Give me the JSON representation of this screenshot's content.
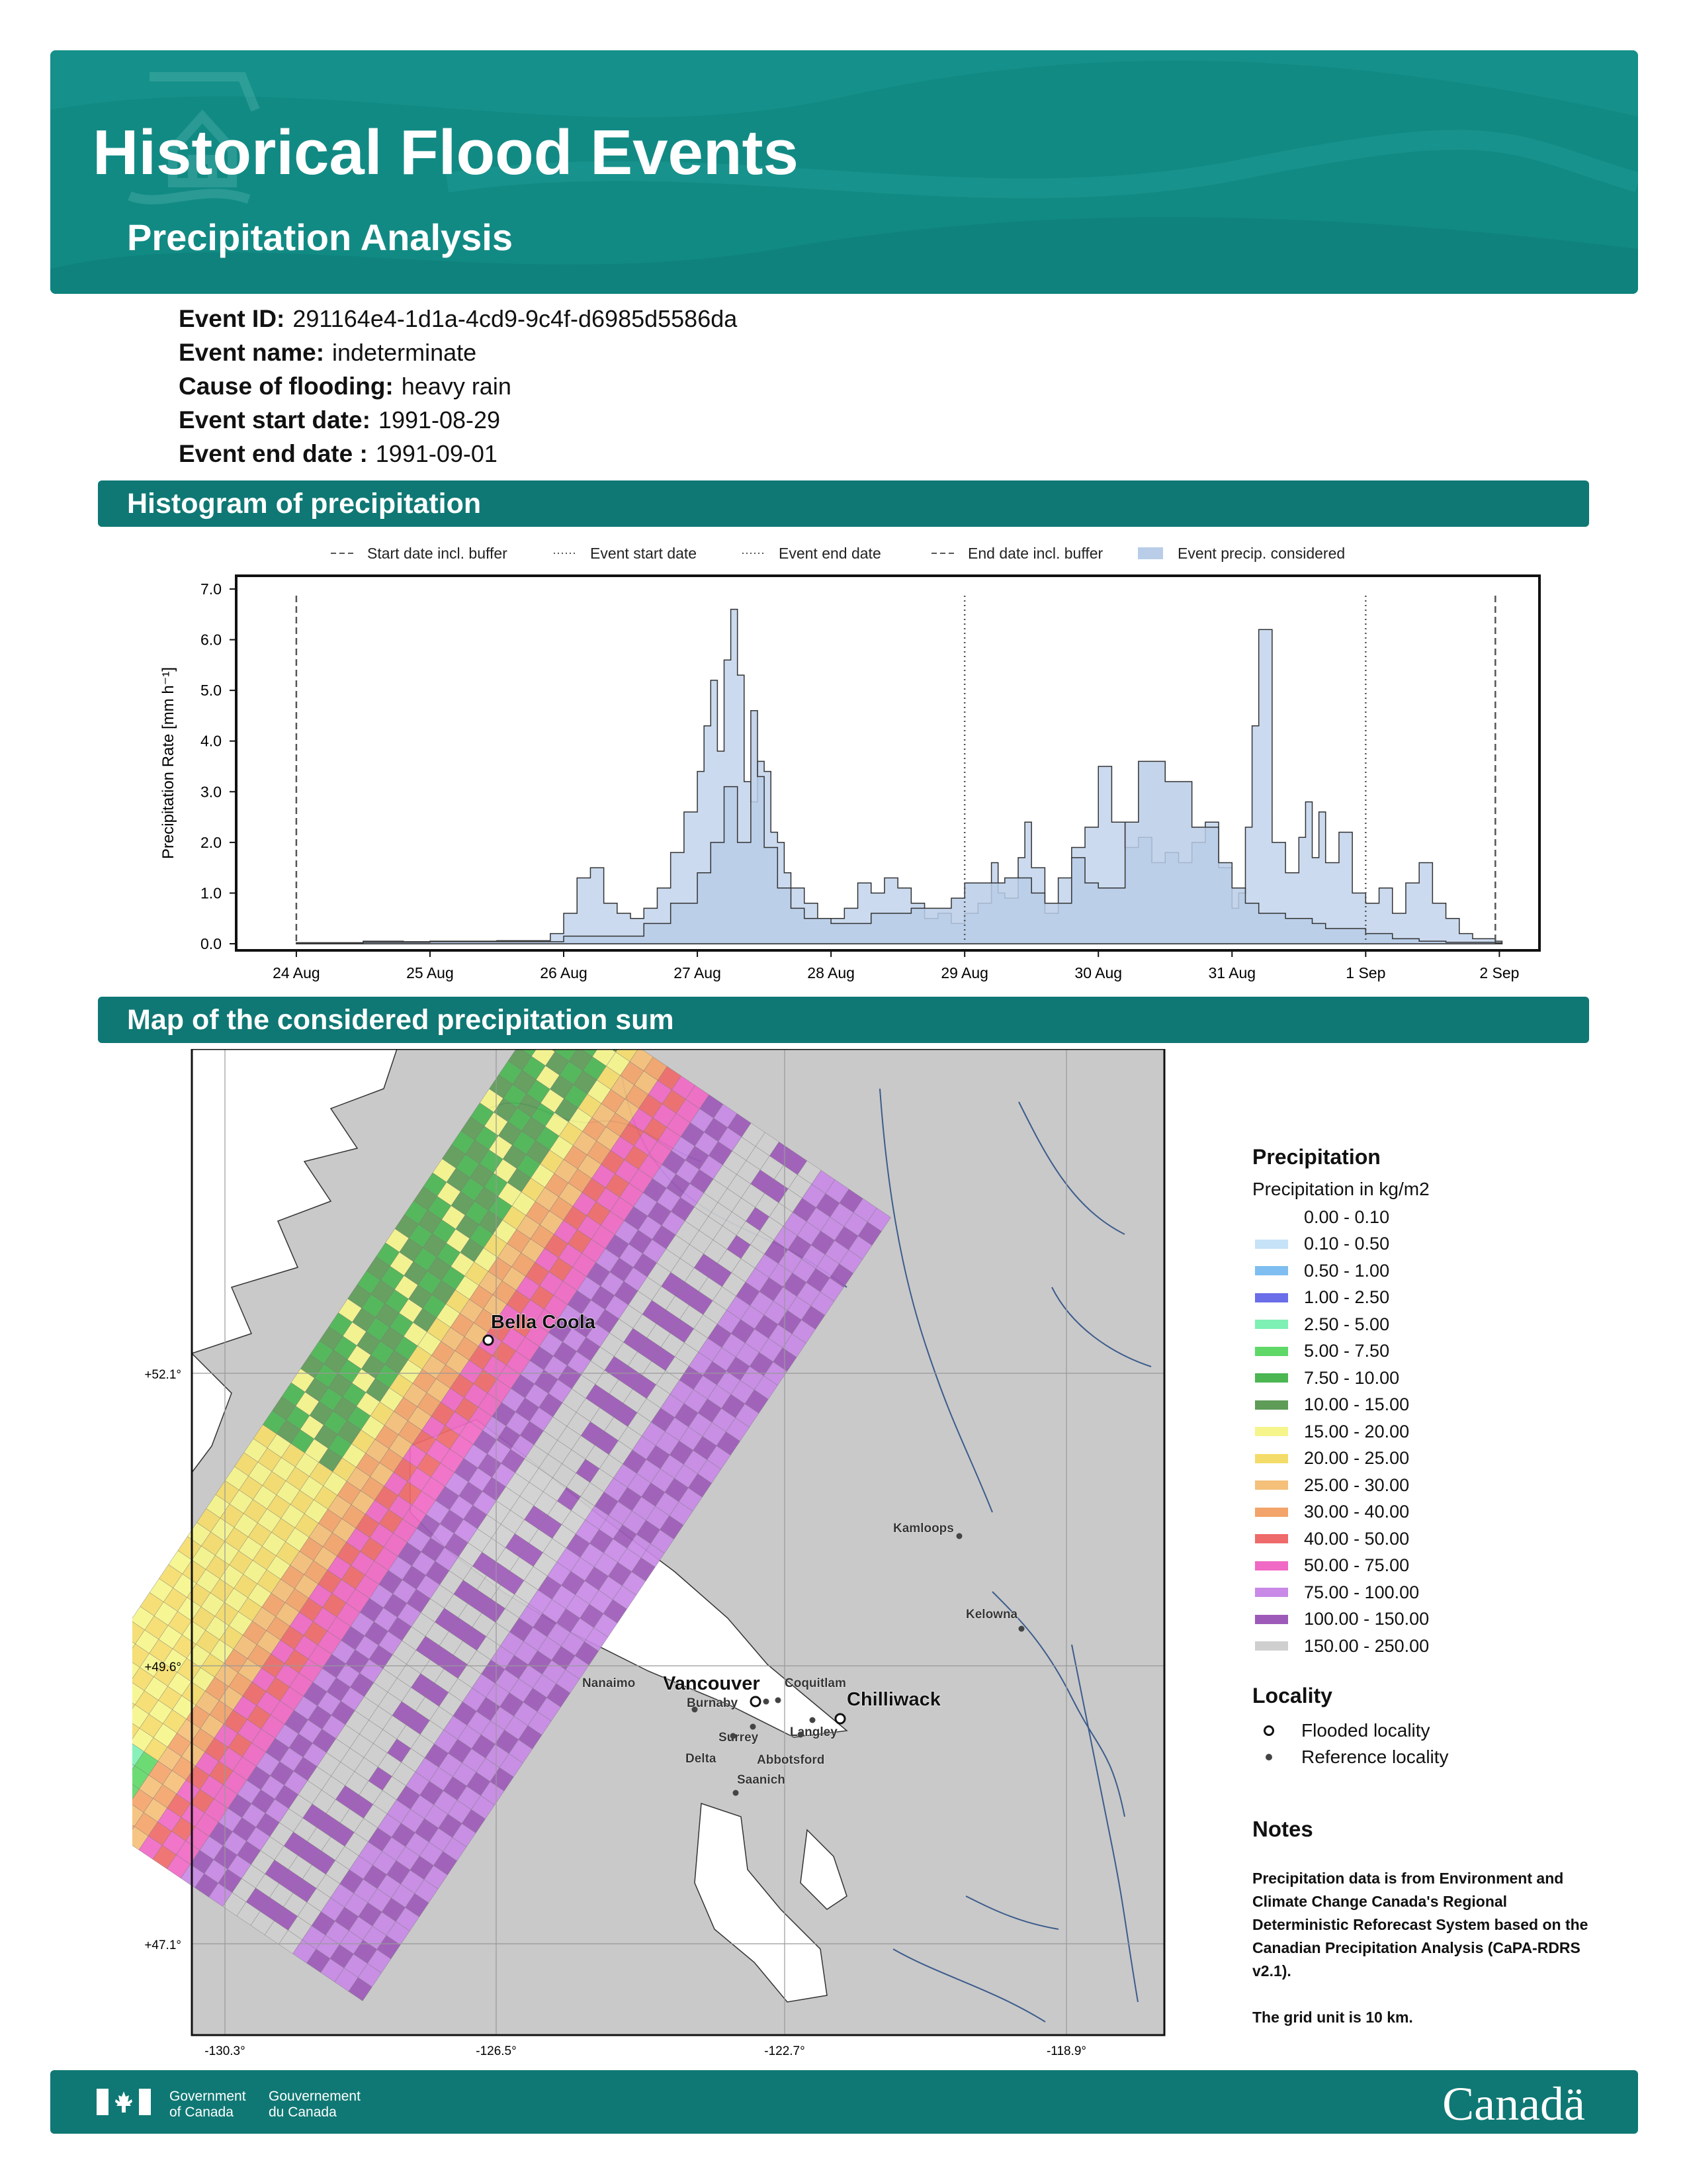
{
  "header": {
    "title": "Historical Flood Events",
    "subtitle": "Precipitation Analysis"
  },
  "event": [
    {
      "label": "Event ID:",
      "value": "291164e4-1d1a-4cd9-9c4f-d6985d5586da"
    },
    {
      "label": "Event name:",
      "value": "indeterminate"
    },
    {
      "label": "Cause of flooding:",
      "value": "heavy rain"
    },
    {
      "label": "Event start date:",
      "value": "1991-08-29"
    },
    {
      "label": "Event end date :",
      "value": "1991-09-01"
    }
  ],
  "sections": {
    "histogram": "Histogram of precipitation",
    "map": "Map of the considered precipitation sum"
  },
  "chart_data": {
    "type": "area",
    "xlabel": "",
    "ylabel": "Precipitation Rate [mm h⁻¹]",
    "ylim": [
      0,
      7
    ],
    "yticks": [
      "0.0",
      "1.0",
      "2.0",
      "3.0",
      "4.0",
      "5.0",
      "6.0",
      "7.0"
    ],
    "xticks": [
      "24 Aug",
      "25 Aug",
      "26 Aug",
      "27 Aug",
      "28 Aug",
      "29 Aug",
      "30 Aug",
      "31 Aug",
      "1 Sep",
      "2 Sep"
    ],
    "x_unit": "days after 24 Aug 00:00",
    "legend": [
      "Start date incl. buffer",
      "Event start date",
      "Event end date",
      "End date incl. buffer",
      "Event precip. considered"
    ],
    "vlines": [
      {
        "name": "Start date incl. buffer",
        "x": 0.0,
        "style": "dashed"
      },
      {
        "name": "Event start date",
        "x": 5.0,
        "style": "dotted"
      },
      {
        "name": "Event end date",
        "x": 8.0,
        "style": "dotted"
      },
      {
        "name": "End date incl. buffer",
        "x": 8.97,
        "style": "dashed"
      }
    ],
    "fill_color": "#b9cde8",
    "series": [
      {
        "x": [
          0,
          0.5,
          0.8,
          1,
          1.5,
          1.9,
          2,
          2.1,
          2.2,
          2.3,
          2.4,
          2.5,
          2.6,
          2.7,
          2.8,
          2.9,
          3,
          3.05,
          3.1,
          3.15,
          3.2,
          3.25,
          3.3,
          3.35,
          3.4,
          3.45,
          3.5,
          3.55,
          3.6,
          3.65,
          3.7,
          3.8,
          3.9,
          4,
          4.1,
          4.2,
          4.3,
          4.4,
          4.5,
          4.6,
          4.7,
          4.8,
          4.9,
          5,
          5.1,
          5.2,
          5.25,
          5.3,
          5.4,
          5.45,
          5.5,
          5.6,
          5.7,
          5.8,
          5.9,
          6,
          6.1,
          6.2,
          6.3,
          6.4,
          6.5,
          6.6,
          6.7,
          6.8,
          6.9,
          7,
          7.05,
          7.1,
          7.15,
          7.2,
          7.3,
          7.4,
          7.5,
          7.55,
          7.6,
          7.65,
          7.7,
          7.8,
          7.9,
          8,
          8.1,
          8.2,
          8.3,
          8.4,
          8.5,
          8.6,
          8.7,
          8.8,
          8.97
        ],
        "y": [
          0.02,
          0.05,
          0.04,
          0.05,
          0.06,
          0.2,
          0.6,
          1.3,
          1.5,
          0.8,
          0.6,
          0.5,
          0.7,
          1.1,
          1.8,
          2.6,
          3.4,
          4.3,
          5.2,
          3.8,
          5.6,
          6.6,
          5.3,
          3.2,
          2.8,
          3.6,
          3.4,
          2.2,
          2.0,
          1.4,
          1.1,
          0.8,
          0.5,
          0.5,
          0.7,
          1.2,
          1.0,
          1.3,
          1.1,
          0.8,
          0.5,
          0.6,
          0.4,
          0.6,
          0.8,
          1.6,
          1.0,
          0.9,
          1.7,
          2.4,
          1.5,
          0.6,
          1.3,
          1.9,
          2.3,
          3.5,
          2.4,
          1.9,
          2.1,
          1.6,
          1.8,
          1.6,
          2.0,
          2.4,
          1.5,
          0.7,
          1.0,
          2.3,
          4.3,
          6.2,
          2.0,
          1.4,
          2.1,
          2.8,
          1.7,
          2.6,
          1.6,
          2.2,
          1.0,
          0.8,
          1.1,
          0.6,
          1.2,
          1.6,
          0.8,
          0.5,
          0.2,
          0.1,
          0.05
        ]
      },
      {
        "x": [
          0,
          0.5,
          1,
          2,
          2.6,
          2.8,
          3,
          3.1,
          3.2,
          3.3,
          3.4,
          3.45,
          3.5,
          3.6,
          3.7,
          3.8,
          4,
          4.3,
          4.6,
          4.9,
          5,
          5.3,
          5.5,
          5.6,
          5.8,
          5.9,
          6,
          6.2,
          6.3,
          6.5,
          6.7,
          6.9,
          7,
          7.1,
          7.2,
          7.4,
          7.6,
          7.7,
          7.9,
          8,
          8.2,
          8.4,
          8.6,
          8.97
        ],
        "y": [
          0.02,
          0.03,
          0.04,
          0.15,
          0.4,
          0.8,
          1.4,
          2.0,
          3.1,
          2.0,
          4.6,
          3.3,
          1.9,
          1.1,
          0.7,
          0.5,
          0.4,
          0.6,
          0.7,
          0.9,
          1.2,
          1.3,
          1.0,
          0.8,
          1.7,
          1.2,
          1.1,
          2.4,
          3.6,
          3.2,
          2.3,
          1.6,
          1.1,
          0.8,
          0.6,
          0.5,
          0.4,
          0.3,
          0.3,
          0.2,
          0.1,
          0.05,
          0.03,
          0.02
        ]
      }
    ]
  },
  "map": {
    "lat_labels": [
      "+52.1°",
      "+49.6°",
      "+47.1°"
    ],
    "lon_labels": [
      "-130.3°",
      "-126.5°",
      "-122.7°",
      "-118.9°"
    ],
    "flooded": [
      "Bella Coola",
      "Vancouver",
      "Chilliwack"
    ],
    "reference": [
      "Coquitlam",
      "Nanaimo",
      "Burnaby",
      "Surrey",
      "Langley",
      "Delta",
      "Abbotsford",
      "Saanich",
      "Kamloops",
      "Kelowna"
    ]
  },
  "legend": {
    "title": "Precipitation",
    "subtitle": "Precipitation in kg/m2",
    "items": [
      {
        "label": "0.00 - 0.10",
        "color": "#ffffff"
      },
      {
        "label": "0.10 - 0.50",
        "color": "#c6e2f7"
      },
      {
        "label": "0.50 - 1.00",
        "color": "#7ebef0"
      },
      {
        "label": "1.00 - 2.50",
        "color": "#6a6ee8"
      },
      {
        "label": "2.50 - 5.00",
        "color": "#7ef0b4"
      },
      {
        "label": "5.00 - 7.50",
        "color": "#5fd868"
      },
      {
        "label": "7.50 - 10.00",
        "color": "#4cb653"
      },
      {
        "label": "10.00 - 15.00",
        "color": "#5e9c58"
      },
      {
        "label": "15.00 - 20.00",
        "color": "#f6f58c"
      },
      {
        "label": "20.00 - 25.00",
        "color": "#f4dc6a"
      },
      {
        "label": "25.00 - 30.00",
        "color": "#f5c07a"
      },
      {
        "label": "30.00 - 40.00",
        "color": "#f3a46a"
      },
      {
        "label": "40.00 - 50.00",
        "color": "#ef6a6a"
      },
      {
        "label": "50.00 - 75.00",
        "color": "#f069c4"
      },
      {
        "label": "75.00 - 100.00",
        "color": "#c88ae6"
      },
      {
        "label": "100.00 - 150.00",
        "color": "#9d5ab8"
      },
      {
        "label": "150.00 - 250.00",
        "color": "#cfcfcf"
      }
    ],
    "locality_title": "Locality",
    "flooded_label": "Flooded locality",
    "reference_label": "Reference locality"
  },
  "notes": {
    "title": "Notes",
    "text1": "Precipitation data is from Environment and Climate Change Canada's Regional Deterministic Reforecast System based on the Canadian Precipitation Analysis (CaPA-RDRS v2.1).",
    "text2": "The grid unit is 10 km."
  },
  "footer": {
    "gov_en_1": "Government",
    "gov_en_2": "of Canada",
    "gov_fr_1": "Gouvernement",
    "gov_fr_2": "du Canada",
    "wordmark": "Canadä"
  }
}
